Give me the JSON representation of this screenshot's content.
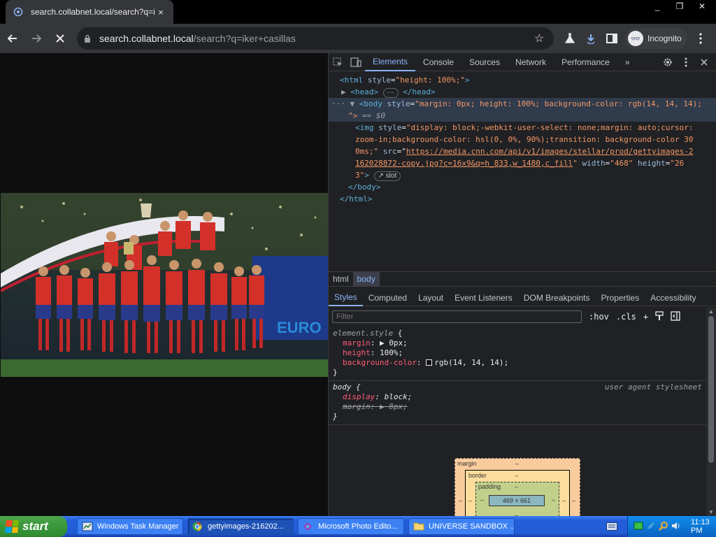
{
  "browser": {
    "tab_title": "search.collabnet.local/search?q=ike",
    "tab_close": "×",
    "url_host": "search.collabnet.local",
    "url_path": "/search?q=iker+casillas",
    "incognito_label": "Incognito",
    "window_buttons": [
      "_",
      "❐",
      "✕"
    ]
  },
  "devtools": {
    "tabs": [
      "Elements",
      "Console",
      "Sources",
      "Network",
      "Performance"
    ],
    "active_tab": "Elements",
    "more": "»",
    "dom": {
      "html_open": "<html",
      "html_attr": "style",
      "html_val": "\"height: 100%;\"",
      "head": "<head>",
      "head_ellipsis": "···",
      "head_close": "</head>",
      "body_open": "<body",
      "body_attr": "style",
      "body_val": "\"margin: 0px; height: 100%; background-color: rgb(14, 14, 14);",
      "body_val_end": "\">",
      "eq0": "== $0",
      "img_open": "<img",
      "img_style_attr": "style",
      "img_style_l1": "\"display: block;-webkit-user-select: none;margin: auto;cursor:",
      "img_style_l2": "zoom-in;background-color: hsl(0, 0%, 90%);transition: background-color 30",
      "img_style_l3": "0ms;\"",
      "img_src_attr": "src",
      "img_src_l1": "https://media.cnn.com/api/v1/images/stellar/prod/gettyimages-2",
      "img_src_l2": "162028872-copy.jpg?c=16x9&q=h_833,w_1480,c_fill",
      "img_width_attr": "width",
      "img_width_val": "\"468\"",
      "img_height_attr": "height",
      "img_height_val_a": "\"26",
      "img_height_val_b": "3\"",
      "img_close": ">",
      "slot": "slot",
      "body_close": "</body>",
      "html_close": "</html>"
    },
    "breadcrumbs": [
      "html",
      "body"
    ],
    "active_crumb": "body",
    "subtabs": [
      "Styles",
      "Computed",
      "Layout",
      "Event Listeners",
      "DOM Breakpoints",
      "Properties",
      "Accessibility"
    ],
    "active_subtab": "Styles",
    "filter_placeholder": "Filter",
    "hov": ":hov",
    "cls": ".cls",
    "plus": "+",
    "styles": {
      "element_style_selector": "element.style",
      "open_brace": "{",
      "close_brace": "}",
      "es_props": [
        {
          "name": "margin",
          "value": "0px",
          "arrow": "▶ "
        },
        {
          "name": "height",
          "value": "100%",
          "arrow": ""
        },
        {
          "name": "background-color",
          "value": "rgb(14, 14, 14)",
          "arrow": ""
        }
      ],
      "ua_selector": "body {",
      "ua_source": "user agent stylesheet",
      "ua_props": [
        {
          "name": "display",
          "value": "block"
        },
        {
          "name": "margin",
          "value": "8px"
        }
      ]
    },
    "box_model": {
      "margin_label": "margin",
      "border_label": "border",
      "padding_label": "padding",
      "dash": "–",
      "content": "469 × 661"
    }
  },
  "taskbar": {
    "start_label": "start",
    "tasks": [
      {
        "label": "Windows Task Manager",
        "active": false
      },
      {
        "label": "gettyimages-216202...",
        "active": true
      },
      {
        "label": "Microsoft Photo Edito...",
        "active": false
      },
      {
        "label": "UNIVERSE SANDBOX ...",
        "active": false
      }
    ],
    "clock": "11:13 PM"
  },
  "colors": {
    "page_bg": "#0e0e0e",
    "devtools_accent": "#8ab4f8",
    "xp_taskbar": "#245edb",
    "xp_start": "#3c9a3c"
  }
}
